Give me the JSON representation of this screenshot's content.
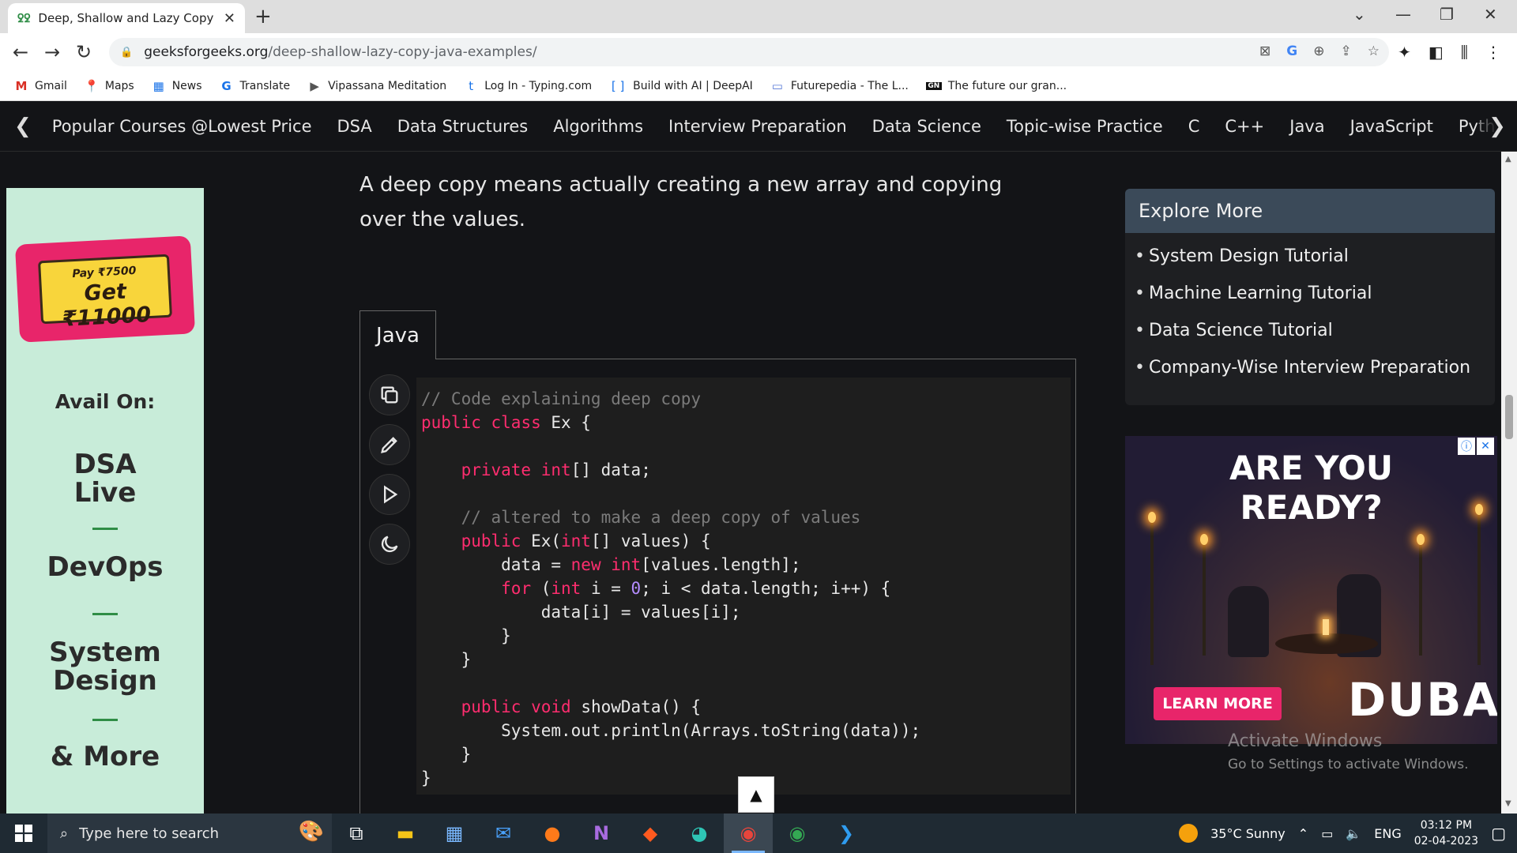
{
  "browser": {
    "tab_title": "Deep, Shallow and Lazy Copy wit",
    "url_domain": "geeksforgeeks.org",
    "url_path": "/deep-shallow-lazy-copy-java-examples/",
    "bookmarks": [
      {
        "icon": "M",
        "label": "Gmail"
      },
      {
        "icon": "📍",
        "label": "Maps"
      },
      {
        "icon": "▦",
        "label": "News"
      },
      {
        "icon": "G",
        "label": "Translate"
      },
      {
        "icon": "▶",
        "label": "Vipassana Meditation"
      },
      {
        "icon": "t",
        "label": "Log In - Typing.com"
      },
      {
        "icon": "[ ]",
        "label": "Build with AI | DeepAI"
      },
      {
        "icon": "▭",
        "label": "Futurepedia - The L..."
      },
      {
        "icon": "GN",
        "label": "The future our gran..."
      }
    ]
  },
  "site_nav": {
    "items": [
      "Popular Courses @Lowest Price",
      "DSA",
      "Data Structures",
      "Algorithms",
      "Interview Preparation",
      "Data Science",
      "Topic-wise Practice",
      "C",
      "C++",
      "Java",
      "JavaScript",
      "Pyth"
    ]
  },
  "left_ad": {
    "pay": "Pay ₹7500",
    "get": "Get ₹11000",
    "avail": "Avail On:",
    "items": [
      "DSA Live",
      "DevOps",
      "System Design",
      "& More"
    ]
  },
  "article": {
    "paragraph": "A deep copy means actually creating a new array and copying over the values.",
    "code_tab": "Java",
    "code_lines": [
      [
        {
          "c": "cm",
          "t": "// Code explaining deep copy"
        }
      ],
      [
        {
          "c": "kw",
          "t": "public"
        },
        {
          "c": "",
          "t": " "
        },
        {
          "c": "kw",
          "t": "class"
        },
        {
          "c": "",
          "t": " Ex {"
        }
      ],
      [
        {
          "c": "",
          "t": ""
        }
      ],
      [
        {
          "c": "",
          "t": "    "
        },
        {
          "c": "kw",
          "t": "private"
        },
        {
          "c": "",
          "t": " "
        },
        {
          "c": "kw",
          "t": "int"
        },
        {
          "c": "",
          "t": "[] data;"
        }
      ],
      [
        {
          "c": "",
          "t": ""
        }
      ],
      [
        {
          "c": "",
          "t": "    "
        },
        {
          "c": "cm",
          "t": "// altered to make a deep copy of values"
        }
      ],
      [
        {
          "c": "",
          "t": "    "
        },
        {
          "c": "kw",
          "t": "public"
        },
        {
          "c": "",
          "t": " Ex("
        },
        {
          "c": "kw",
          "t": "int"
        },
        {
          "c": "",
          "t": "[] values) {"
        }
      ],
      [
        {
          "c": "",
          "t": "        data = "
        },
        {
          "c": "kw",
          "t": "new"
        },
        {
          "c": "",
          "t": " "
        },
        {
          "c": "kw",
          "t": "int"
        },
        {
          "c": "",
          "t": "[values.length];"
        }
      ],
      [
        {
          "c": "",
          "t": "        "
        },
        {
          "c": "kw",
          "t": "for"
        },
        {
          "c": "",
          "t": " ("
        },
        {
          "c": "kw",
          "t": "int"
        },
        {
          "c": "",
          "t": " i = "
        },
        {
          "c": "num",
          "t": "0"
        },
        {
          "c": "",
          "t": "; i < data.length; i++) {"
        }
      ],
      [
        {
          "c": "",
          "t": "            data[i] = values[i];"
        }
      ],
      [
        {
          "c": "",
          "t": "        }"
        }
      ],
      [
        {
          "c": "",
          "t": "    }"
        }
      ],
      [
        {
          "c": "",
          "t": ""
        }
      ],
      [
        {
          "c": "",
          "t": "    "
        },
        {
          "c": "kw",
          "t": "public"
        },
        {
          "c": "",
          "t": " "
        },
        {
          "c": "kw",
          "t": "void"
        },
        {
          "c": "",
          "t": " showData() {"
        }
      ],
      [
        {
          "c": "",
          "t": "        System.out.println(Arrays.toString(data));"
        }
      ],
      [
        {
          "c": "",
          "t": "    }"
        }
      ],
      [
        {
          "c": "",
          "t": "}"
        }
      ]
    ]
  },
  "sidebar": {
    "explore_title": "Explore More",
    "explore_items": [
      "System Design Tutorial",
      "Machine Learning Tutorial",
      "Data Science Tutorial",
      "Company-Wise Interview Preparation"
    ]
  },
  "right_ad": {
    "headline_1": "ARE YOU",
    "headline_2": "READY?",
    "cta": "LEARN MORE",
    "brand": "DUBAI"
  },
  "watermark": {
    "title": "Activate Windows",
    "subtitle": "Go to Settings to activate Windows."
  },
  "taskbar": {
    "search_placeholder": "Type here to search",
    "weather": "35°C  Sunny",
    "lang": "ENG",
    "time": "03:12 PM",
    "date": "02-04-2023"
  }
}
